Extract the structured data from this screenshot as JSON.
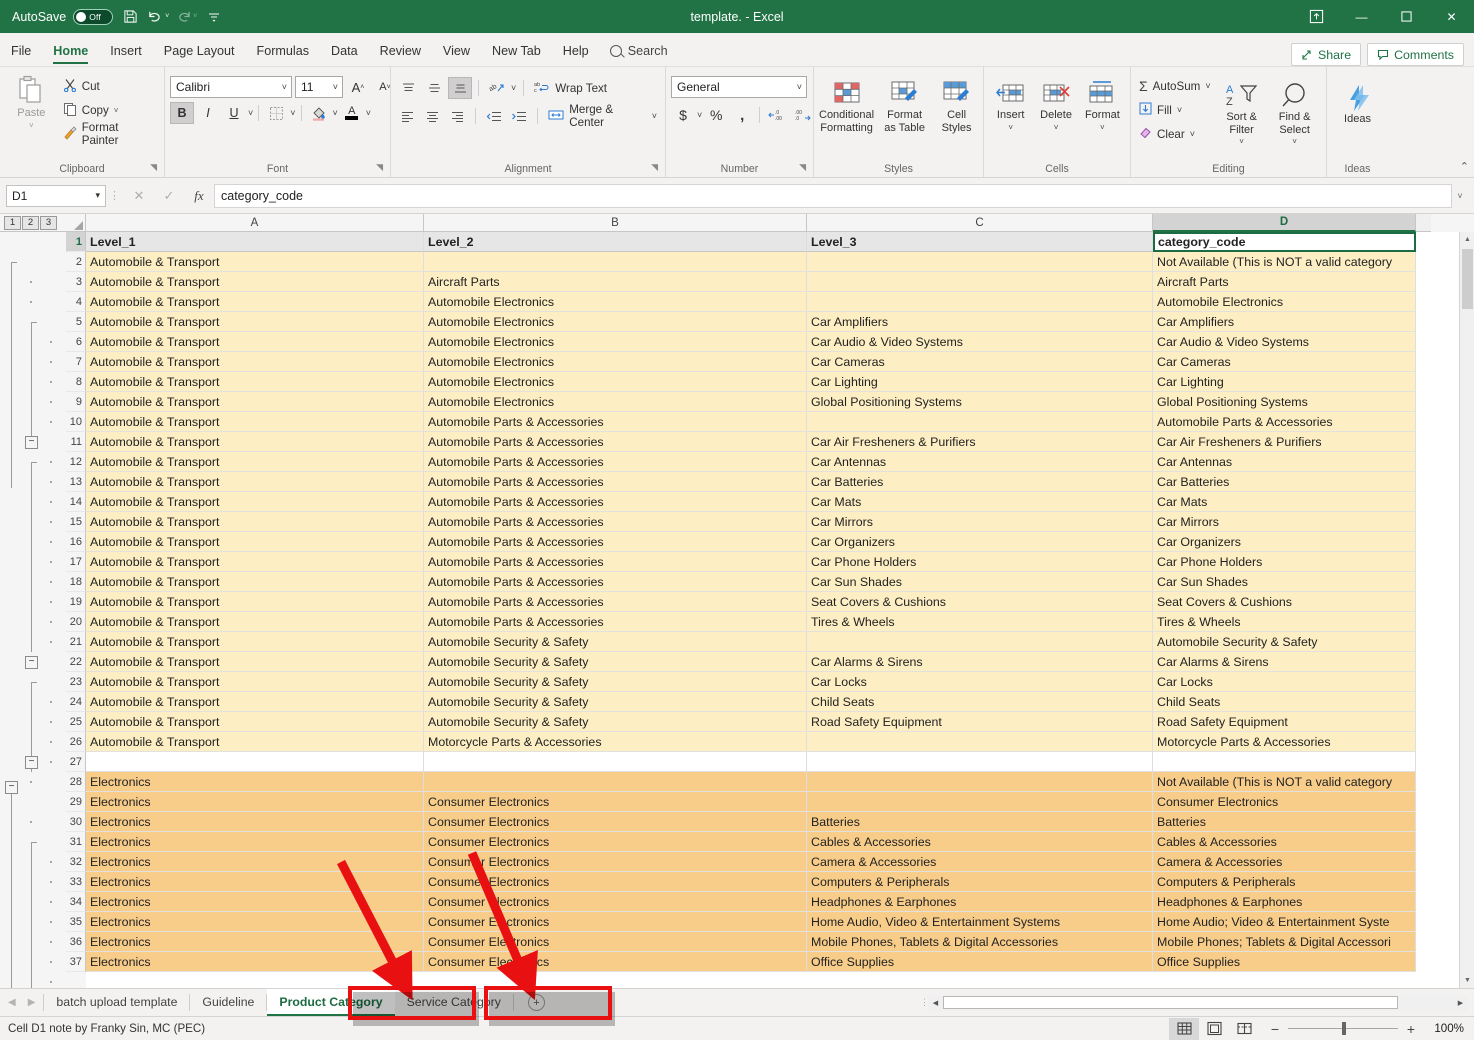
{
  "window": {
    "title": "template.  -  Excel",
    "autosave_label": "AutoSave",
    "autosave_state": "Off",
    "save_icon": "save-icon",
    "undo_icon": "undo-icon",
    "redo_icon": "redo-icon",
    "customize_icon": "customize-quick-access-icon",
    "ribbon_display_icon": "ribbon-display-options-icon",
    "minimize_icon": "minimize-icon",
    "maximize_icon": "maximize-icon",
    "close_icon": "close-icon"
  },
  "menu": {
    "tabs": [
      "File",
      "Home",
      "Insert",
      "Page Layout",
      "Formulas",
      "Data",
      "Review",
      "View",
      "New Tab",
      "Help"
    ],
    "active_tab": "Home",
    "search_placeholder": "Search",
    "share_label": "Share",
    "comments_label": "Comments"
  },
  "ribbon": {
    "groups": [
      {
        "name": "Clipboard",
        "paste_label": "Paste",
        "cut_label": "Cut",
        "copy_label": "Copy",
        "format_painter_label": "Format Painter"
      },
      {
        "name": "Font",
        "font_family": "Calibri",
        "font_size": "11",
        "grow_font": "A",
        "shrink_font": "A",
        "bold": "B",
        "italic": "I",
        "underline": "U"
      },
      {
        "name": "Alignment",
        "wrap_text_label": "Wrap Text",
        "merge_center_label": "Merge & Center"
      },
      {
        "name": "Number",
        "format": "General",
        "currency": "$",
        "percent": "%",
        "comma": ","
      },
      {
        "name": "Styles",
        "conditional_formatting": "Conditional Formatting",
        "format_as_table": "Format as Table",
        "cell_styles": "Cell Styles"
      },
      {
        "name": "Cells",
        "insert": "Insert",
        "delete": "Delete",
        "format": "Format"
      },
      {
        "name": "Editing",
        "autosum": "AutoSum",
        "fill": "Fill",
        "clear": "Clear",
        "sort_filter": "Sort & Filter",
        "find_select": "Find & Select"
      },
      {
        "name": "Ideas",
        "ideas": "Ideas"
      }
    ]
  },
  "formula_bar": {
    "name_box": "D1",
    "cancel_icon": "cancel-icon",
    "enter_icon": "confirm-icon",
    "function_icon": "fx",
    "value": "category_code"
  },
  "grid": {
    "outline_levels": [
      "1",
      "2",
      "3"
    ],
    "columns": [
      {
        "letter": "A",
        "selected": false
      },
      {
        "letter": "B",
        "selected": false
      },
      {
        "letter": "C",
        "selected": false
      },
      {
        "letter": "D",
        "selected": true
      }
    ],
    "header_row": {
      "row_number": "1",
      "A": "Level_1",
      "B": "Level_2",
      "C": "Level_3",
      "D": "category_code"
    },
    "rows": [
      {
        "n": "2",
        "fill": "yellow",
        "A": "Automobile & Transport",
        "B": "",
        "C": "",
        "D": "Not Available (This is NOT a valid category"
      },
      {
        "n": "3",
        "fill": "yellow",
        "A": "Automobile & Transport",
        "B": "Aircraft Parts",
        "C": "",
        "D": "Aircraft Parts"
      },
      {
        "n": "4",
        "fill": "yellow",
        "A": "Automobile & Transport",
        "B": "Automobile Electronics",
        "C": "",
        "D": "Automobile Electronics"
      },
      {
        "n": "5",
        "fill": "yellow",
        "A": "Automobile & Transport",
        "B": "Automobile Electronics",
        "C": "Car Amplifiers",
        "D": "Car Amplifiers"
      },
      {
        "n": "6",
        "fill": "yellow",
        "A": "Automobile & Transport",
        "B": "Automobile Electronics",
        "C": "Car Audio & Video Systems",
        "D": "Car Audio & Video Systems"
      },
      {
        "n": "7",
        "fill": "yellow",
        "A": "Automobile & Transport",
        "B": "Automobile Electronics",
        "C": "Car Cameras",
        "D": "Car Cameras"
      },
      {
        "n": "8",
        "fill": "yellow",
        "A": "Automobile & Transport",
        "B": "Automobile Electronics",
        "C": "Car Lighting",
        "D": "Car Lighting"
      },
      {
        "n": "9",
        "fill": "yellow",
        "A": "Automobile & Transport",
        "B": "Automobile Electronics",
        "C": "Global Positioning Systems",
        "D": "Global Positioning Systems"
      },
      {
        "n": "10",
        "fill": "yellow",
        "A": "Automobile & Transport",
        "B": "Automobile Parts & Accessories",
        "C": "",
        "D": "Automobile Parts & Accessories"
      },
      {
        "n": "11",
        "fill": "yellow",
        "A": "Automobile & Transport",
        "B": "Automobile Parts & Accessories",
        "C": "Car Air Fresheners & Purifiers",
        "D": "Car Air Fresheners & Purifiers"
      },
      {
        "n": "12",
        "fill": "yellow",
        "A": "Automobile & Transport",
        "B": "Automobile Parts & Accessories",
        "C": "Car Antennas",
        "D": "Car Antennas"
      },
      {
        "n": "13",
        "fill": "yellow",
        "A": "Automobile & Transport",
        "B": "Automobile Parts & Accessories",
        "C": "Car Batteries",
        "D": "Car Batteries"
      },
      {
        "n": "14",
        "fill": "yellow",
        "A": "Automobile & Transport",
        "B": "Automobile Parts & Accessories",
        "C": "Car Mats",
        "D": "Car Mats"
      },
      {
        "n": "15",
        "fill": "yellow",
        "A": "Automobile & Transport",
        "B": "Automobile Parts & Accessories",
        "C": "Car Mirrors",
        "D": "Car Mirrors"
      },
      {
        "n": "16",
        "fill": "yellow",
        "A": "Automobile & Transport",
        "B": "Automobile Parts & Accessories",
        "C": "Car Organizers",
        "D": "Car Organizers"
      },
      {
        "n": "17",
        "fill": "yellow",
        "A": "Automobile & Transport",
        "B": "Automobile Parts & Accessories",
        "C": "Car Phone Holders",
        "D": "Car Phone Holders"
      },
      {
        "n": "18",
        "fill": "yellow",
        "A": "Automobile & Transport",
        "B": "Automobile Parts & Accessories",
        "C": "Car Sun Shades",
        "D": "Car Sun Shades"
      },
      {
        "n": "19",
        "fill": "yellow",
        "A": "Automobile & Transport",
        "B": "Automobile Parts & Accessories",
        "C": "Seat Covers & Cushions",
        "D": "Seat Covers & Cushions"
      },
      {
        "n": "20",
        "fill": "yellow",
        "A": "Automobile & Transport",
        "B": "Automobile Parts & Accessories",
        "C": "Tires & Wheels",
        "D": "Tires & Wheels"
      },
      {
        "n": "21",
        "fill": "yellow",
        "A": "Automobile & Transport",
        "B": "Automobile Security & Safety",
        "C": "",
        "D": "Automobile Security & Safety"
      },
      {
        "n": "22",
        "fill": "yellow",
        "A": "Automobile & Transport",
        "B": "Automobile Security & Safety",
        "C": "Car Alarms & Sirens",
        "D": "Car Alarms & Sirens"
      },
      {
        "n": "23",
        "fill": "yellow",
        "A": "Automobile & Transport",
        "B": "Automobile Security & Safety",
        "C": "Car Locks",
        "D": "Car Locks"
      },
      {
        "n": "24",
        "fill": "yellow",
        "A": "Automobile & Transport",
        "B": "Automobile Security & Safety",
        "C": "Child Seats",
        "D": "Child Seats"
      },
      {
        "n": "25",
        "fill": "yellow",
        "A": "Automobile & Transport",
        "B": "Automobile Security & Safety",
        "C": "Road Safety Equipment",
        "D": "Road Safety Equipment"
      },
      {
        "n": "26",
        "fill": "yellow",
        "A": "Automobile & Transport",
        "B": "Motorcycle Parts & Accessories",
        "C": "",
        "D": "Motorcycle Parts & Accessories"
      },
      {
        "n": "27",
        "fill": "white",
        "A": "",
        "B": "",
        "C": "",
        "D": ""
      },
      {
        "n": "28",
        "fill": "orange",
        "A": "Electronics",
        "B": "",
        "C": "",
        "D": "Not Available (This is NOT a valid category"
      },
      {
        "n": "29",
        "fill": "orange",
        "A": "Electronics",
        "B": "Consumer Electronics",
        "C": "",
        "D": "Consumer Electronics"
      },
      {
        "n": "30",
        "fill": "orange",
        "A": "Electronics",
        "B": "Consumer Electronics",
        "C": "Batteries",
        "D": "Batteries"
      },
      {
        "n": "31",
        "fill": "orange",
        "A": "Electronics",
        "B": "Consumer Electronics",
        "C": "Cables & Accessories",
        "D": "Cables & Accessories"
      },
      {
        "n": "32",
        "fill": "orange",
        "A": "Electronics",
        "B": "Consumer Electronics",
        "C": "Camera & Accessories",
        "D": "Camera & Accessories"
      },
      {
        "n": "33",
        "fill": "orange",
        "A": "Electronics",
        "B": "Consumer Electronics",
        "C": "Computers & Peripherals",
        "D": "Computers & Peripherals"
      },
      {
        "n": "34",
        "fill": "orange",
        "A": "Electronics",
        "B": "Consumer Electronics",
        "C": "Headphones & Earphones",
        "D": "Headphones & Earphones"
      },
      {
        "n": "35",
        "fill": "orange",
        "A": "Electronics",
        "B": "Consumer Electronics",
        "C": "Home Audio, Video & Entertainment Systems",
        "D": "Home Audio; Video & Entertainment Syste"
      },
      {
        "n": "36",
        "fill": "orange",
        "A": "Electronics",
        "B": "Consumer Electronics",
        "C": "Mobile Phones, Tablets & Digital Accessories",
        "D": "Mobile Phones; Tablets & Digital Accessori"
      },
      {
        "n": "37",
        "fill": "orange",
        "A": "Electronics",
        "B": "Consumer Electronics",
        "C": "Office Supplies",
        "D": "Office Supplies"
      }
    ]
  },
  "sheet_tabs": {
    "prev_icon": "previous-sheet-icon",
    "next_icon": "next-sheet-icon",
    "tabs": [
      {
        "label": "batch upload template",
        "active": false
      },
      {
        "label": "Guideline",
        "active": false
      },
      {
        "label": "Product Category",
        "active": true
      },
      {
        "label": "Service Category",
        "active": false
      }
    ],
    "add_label": "+"
  },
  "status_bar": {
    "message": "Cell D1 note by Franky Sin, MC (PEC)",
    "views": [
      "normal-view-icon",
      "page-layout-view-icon",
      "page-break-preview-icon"
    ],
    "active_view": "normal-view-icon",
    "zoom_out": "−",
    "zoom_in": "+",
    "zoom_level": "100%"
  },
  "annotations": {
    "highlight_color": "#e81010",
    "boxes": [
      {
        "target": "Product Category"
      },
      {
        "target": "Service Category"
      }
    ],
    "arrows": 2
  }
}
